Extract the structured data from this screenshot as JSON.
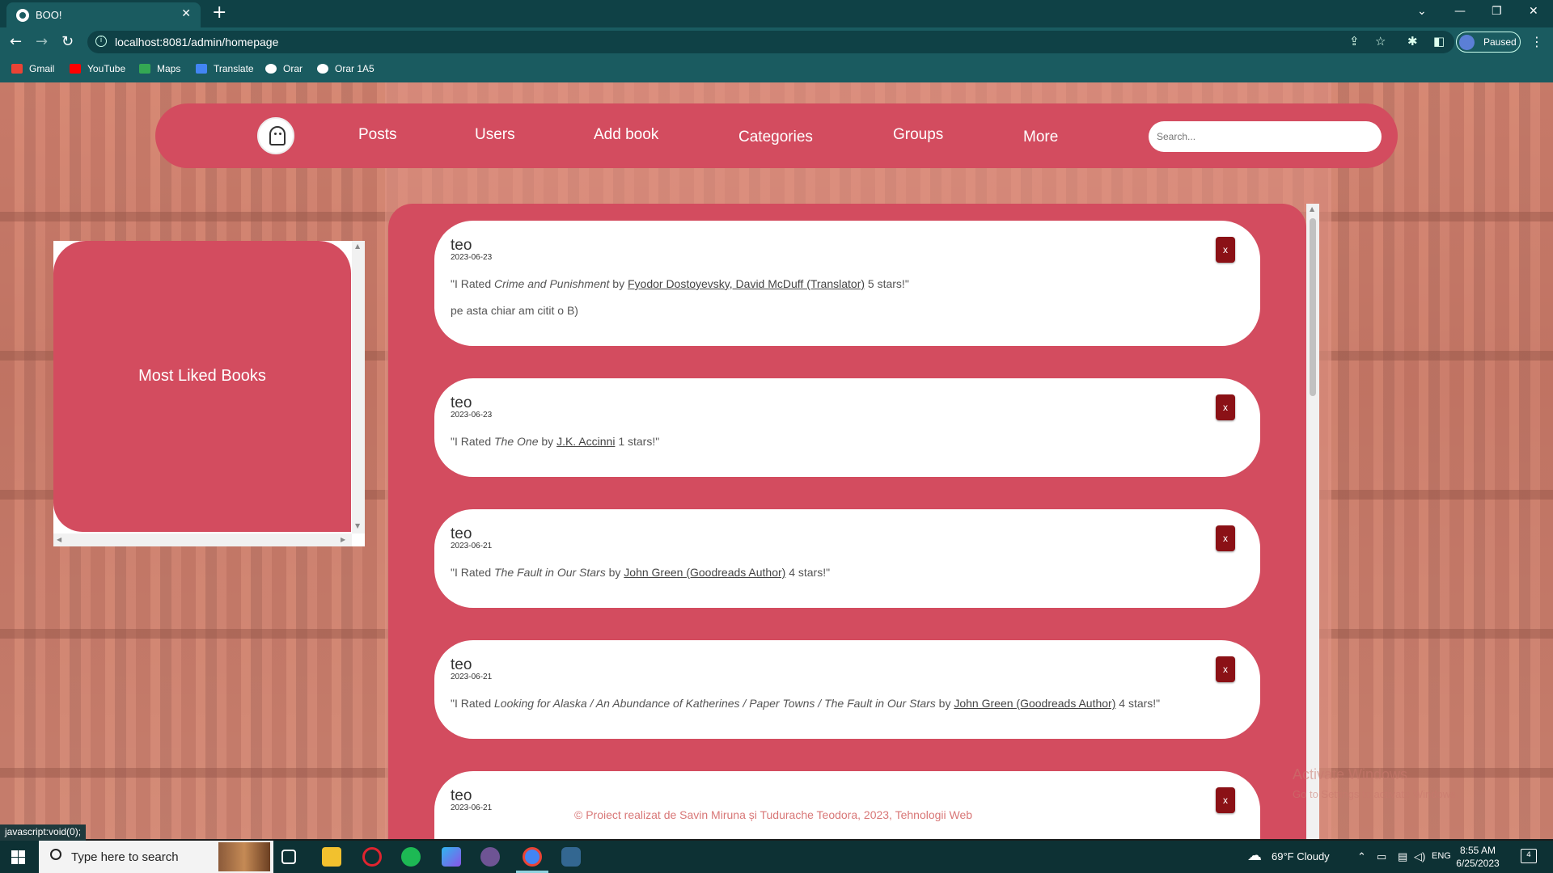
{
  "browser": {
    "tab_title": "BOO!",
    "url": "localhost:8081/admin/homepage",
    "profile_status": "Paused",
    "bookmarks": [
      {
        "label": "Gmail",
        "color": "#ea4335"
      },
      {
        "label": "YouTube",
        "color": "#ff0000"
      },
      {
        "label": "Maps",
        "color": "#34a853"
      },
      {
        "label": "Translate",
        "color": "#4285f4"
      },
      {
        "label": "Orar",
        "color": "#ffffff"
      },
      {
        "label": "Orar 1A5",
        "color": "#ffffff"
      }
    ]
  },
  "nav": {
    "links": [
      "Posts",
      "Users",
      "Add book",
      "Categories",
      "Groups",
      "More"
    ],
    "search_placeholder": "Search..."
  },
  "sidebar": {
    "title": "Most Liked Books"
  },
  "posts": [
    {
      "user": "teo",
      "date": "2023-06-23",
      "prefix": "\"I Rated ",
      "book": "Crime and Punishment",
      "by": " by ",
      "author": "Fyodor Dostoyevsky, David McDuff (Translator)",
      "suffix": " 5 stars!\"",
      "comment": "pe asta chiar am citit o B)",
      "delete_label": "x"
    },
    {
      "user": "teo",
      "date": "2023-06-23",
      "prefix": "\"I Rated ",
      "book": "The One",
      "by": " by ",
      "author": "J.K. Accinni",
      "suffix": " 1 stars!\"",
      "delete_label": "x"
    },
    {
      "user": "teo",
      "date": "2023-06-21",
      "prefix": "\"I Rated ",
      "book": "The Fault in Our Stars",
      "by": " by ",
      "author": "John Green (Goodreads Author)",
      "suffix": " 4 stars!\"",
      "delete_label": "x"
    },
    {
      "user": "teo",
      "date": "2023-06-21",
      "prefix": "\"I Rated ",
      "book": "Looking for Alaska / An Abundance of Katherines / Paper Towns / The Fault in Our Stars",
      "by": " by ",
      "author": "John Green (Goodreads Author)",
      "suffix": " 4 stars!\"",
      "delete_label": "x"
    },
    {
      "user": "teo",
      "date": "2023-06-21",
      "delete_label": "x"
    }
  ],
  "footer": "© Proiect realizat de Savin Miruna și Tudurache Teodora, 2023, Tehnologii Web",
  "watermark": {
    "line1": "Activate Windows",
    "line2": "Go to Settings to activate Windows."
  },
  "status_url": "javascript:void(0);",
  "taskbar": {
    "search_placeholder": "Type here to search",
    "weather": "69°F  Cloudy",
    "language": "ENG",
    "time": "8:55 AM",
    "date": "6/25/2023",
    "notification_count": "4"
  }
}
